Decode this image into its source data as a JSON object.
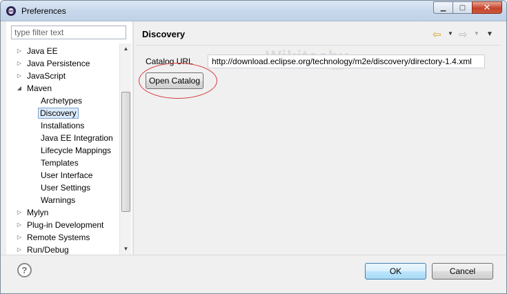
{
  "window": {
    "title": "Preferences"
  },
  "filter": {
    "placeholder": "type filter text"
  },
  "tree": [
    {
      "label": "Java EE",
      "toggle": "▷"
    },
    {
      "label": "Java Persistence",
      "toggle": "▷"
    },
    {
      "label": "JavaScript",
      "toggle": "▷"
    },
    {
      "label": "Maven",
      "toggle": "◢"
    },
    {
      "label": "Archetypes",
      "toggle": ""
    },
    {
      "label": "Discovery",
      "toggle": "",
      "selected": true
    },
    {
      "label": "Installations",
      "toggle": ""
    },
    {
      "label": "Java EE Integration",
      "toggle": ""
    },
    {
      "label": "Lifecycle Mappings",
      "toggle": ""
    },
    {
      "label": "Templates",
      "toggle": ""
    },
    {
      "label": "User Interface",
      "toggle": ""
    },
    {
      "label": "User Settings",
      "toggle": ""
    },
    {
      "label": "Warnings",
      "toggle": ""
    },
    {
      "label": "Mylyn",
      "toggle": "▷"
    },
    {
      "label": "Plug-in Development",
      "toggle": "▷"
    },
    {
      "label": "Remote Systems",
      "toggle": "▷"
    },
    {
      "label": "Run/Debug",
      "toggle": "▷"
    }
  ],
  "page": {
    "title": "Discovery",
    "catalog_label": "Catalog URL",
    "catalog_url": "http://download.eclipse.org/technology/m2e/discovery/directory-1.4.xml",
    "open_catalog": "Open Catalog"
  },
  "watermark": {
    "text": "Wikitechy",
    "sub": ".com"
  },
  "buttons": {
    "ok": "OK",
    "cancel": "Cancel",
    "help": "?"
  },
  "colors": {
    "highlight": "#d63a3a",
    "selection": "#dcebfc",
    "ok_border": "#3c7fb1"
  },
  "icons": [
    "app-icon",
    "back-arrow-icon",
    "forward-arrow-icon",
    "view-menu-icon",
    "help-icon"
  ]
}
